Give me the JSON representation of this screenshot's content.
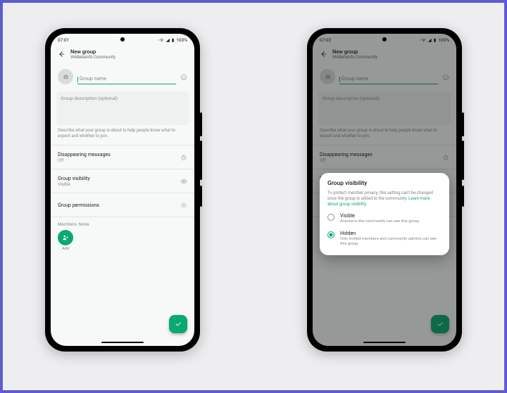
{
  "status": {
    "time_left": "07:01",
    "time_right": "07:02",
    "battery": "100%"
  },
  "header": {
    "title": "New group",
    "subtitle": "WABetaInfo Community"
  },
  "group_name": {
    "placeholder": "Group name"
  },
  "description": {
    "placeholder": "Group description (optional)",
    "hint": "Describe what your group is about to help people know what to expect and whether to join."
  },
  "settings": {
    "disappearing": {
      "label": "Disappearing messages",
      "value": "Off"
    },
    "visibility": {
      "label": "Group visibility",
      "value_visible": "Visible",
      "value_hidden": "Hidden"
    },
    "permissions": {
      "label": "Group permissions"
    }
  },
  "members": {
    "label": "Members: None",
    "add_label": "Add"
  },
  "dialog": {
    "title": "Group visibility",
    "desc_a": "To protect member privacy, this setting can't be changed once the group is added to the community. ",
    "desc_link": "Learn more about group visibility",
    "option_visible": {
      "label": "Visible",
      "sub": "Anyone in the community can see this group."
    },
    "option_hidden": {
      "label": "Hidden",
      "sub": "Only invited members and community admins can see this group."
    }
  }
}
